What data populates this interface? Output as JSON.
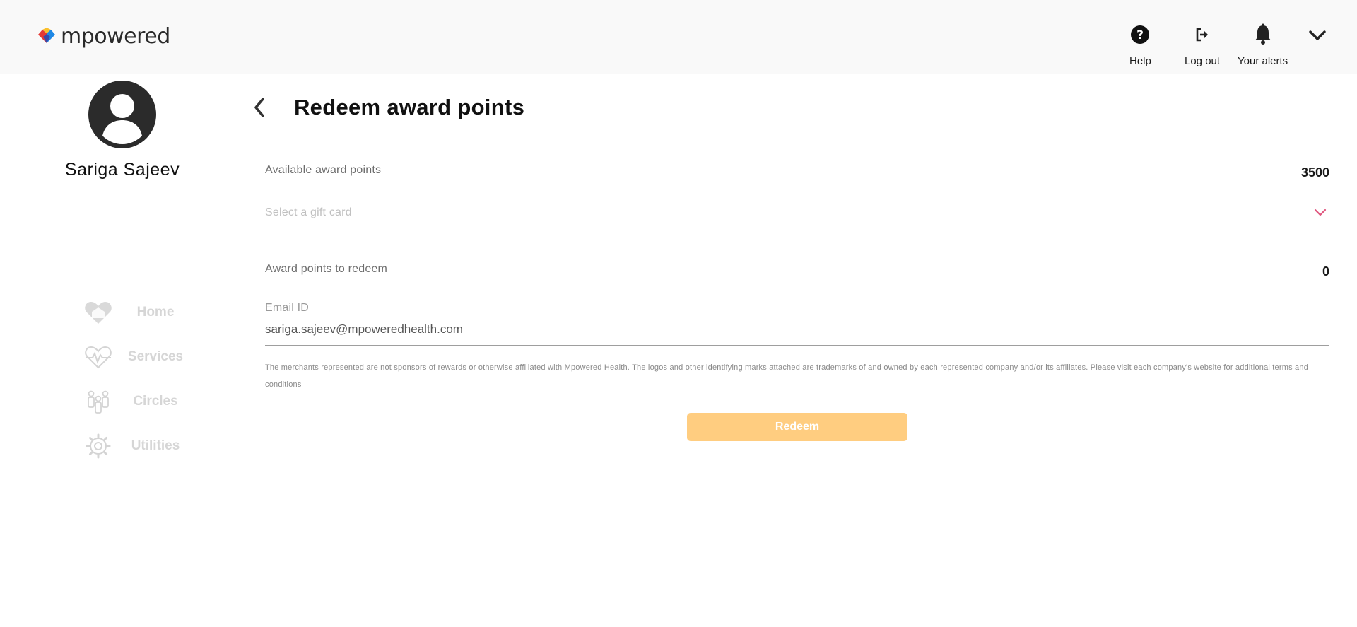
{
  "app": {
    "brand_name": "mpowered"
  },
  "topbar": {
    "help_label": "Help",
    "logout_label": "Log out",
    "alerts_label": "Your alerts"
  },
  "profile": {
    "name": "Sariga Sajeev"
  },
  "nav": {
    "items": [
      {
        "label": "Home",
        "icon": "heart-home-icon"
      },
      {
        "label": "Services",
        "icon": "heartbeat-icon"
      },
      {
        "label": "Circles",
        "icon": "people-icon"
      },
      {
        "label": "Utilities",
        "icon": "gear-icon"
      }
    ]
  },
  "page": {
    "title": "Redeem award points"
  },
  "form": {
    "available_label": "Available award points",
    "available_value": "3500",
    "gift_card_placeholder": "Select a gift card",
    "redeem_points_label": "Award points to redeem",
    "redeem_points_value": "0",
    "email_label": "Email ID",
    "email_value": "sariga.sajeev@mpoweredhealth.com",
    "disclaimer": "The merchants represented are not sponsors of rewards or otherwise affiliated with Mpowered Health. The logos and other identifying marks attached are trademarks of and owned by each represented company and/or its affiliates. Please visit each company's website for additional terms and conditions",
    "redeem_button": "Redeem"
  },
  "colors": {
    "accent_button": "#ffcd80",
    "caret_pink": "#e0567e",
    "topbar_bg": "#f9f9f9",
    "nav_muted": "#d6d6d6"
  }
}
